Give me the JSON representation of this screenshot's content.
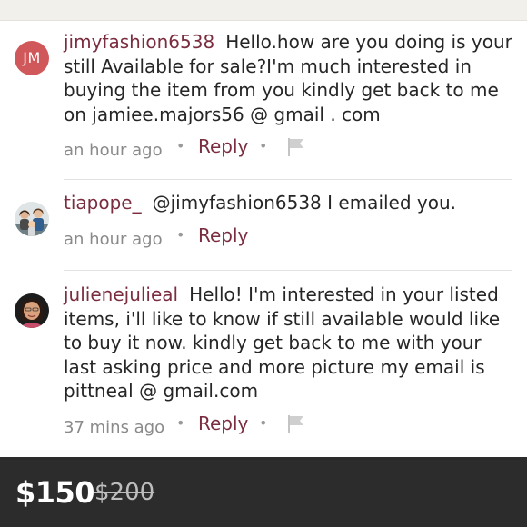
{
  "comments": [
    {
      "avatar_initials": "JM",
      "username": "jimyfashion6538",
      "text": "Hello.how are you doing is your still Available for sale?I'm much interested in buying the item from you kindly get back to me on jamiee.majors56 @ gmail . com",
      "time": "an hour ago",
      "reply_label": "Reply",
      "flag_icon": "flag-icon"
    },
    {
      "username": "tiapope_",
      "text": "@jimyfashion6538 I emailed you.",
      "time": "an hour ago",
      "reply_label": "Reply"
    },
    {
      "username": "julienejulieal",
      "text": "Hello! I'm interested in your listed items, i'll like to know if still available would like to buy it now. kindly get back to me with your last asking price and more picture my email is pittneal @  gmail.com",
      "time": "37 mins ago",
      "reply_label": "Reply",
      "flag_icon": "flag-icon"
    }
  ],
  "separator": "•",
  "price": {
    "current": "$150",
    "original": "$200"
  },
  "colors": {
    "username": "#7b2d40",
    "initials_avatar_bg": "#d0585a",
    "price_bar_bg": "#2c2c2c"
  }
}
